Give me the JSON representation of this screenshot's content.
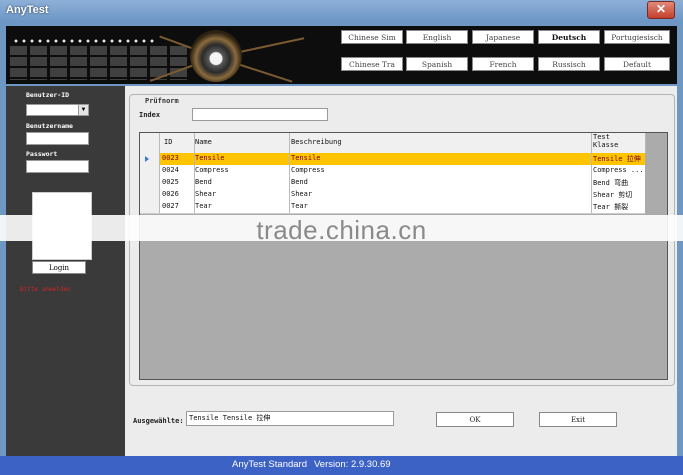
{
  "window": {
    "title": "AnyTest",
    "close_label": "✕"
  },
  "languages": [
    {
      "label": "Chinese Sim",
      "active": false
    },
    {
      "label": "English",
      "active": false
    },
    {
      "label": "Japanese",
      "active": false
    },
    {
      "label": "Deutsch",
      "active": true
    },
    {
      "label": "Portugiesisch",
      "active": false
    },
    {
      "label": "Chinese Tra",
      "active": false
    },
    {
      "label": "Spanish",
      "active": false
    },
    {
      "label": "French",
      "active": false
    },
    {
      "label": "Russisch",
      "active": false
    },
    {
      "label": "Default",
      "active": false
    }
  ],
  "sidebar": {
    "user_id_label": "Benutzer-ID",
    "username_label": "Benutzername",
    "password_label": "Passwort",
    "login_label": "Login",
    "warning": "Bitte anmelden"
  },
  "form": {
    "group_title": "Prüfnorm",
    "index_label": "Index",
    "index_value": "",
    "selected_label": "Ausgewählte:",
    "selected_value": "Tensile   Tensile 拉伸",
    "ok_label": "OK",
    "exit_label": "Exit"
  },
  "table": {
    "headers": [
      "ID",
      "Name",
      "Beschreibung",
      "Test Klasse"
    ],
    "rows": [
      {
        "id": "0023",
        "name": "Tensile",
        "desc": "Tensile",
        "cls": "Tensile 拉伸",
        "selected": true
      },
      {
        "id": "0024",
        "name": "Compress",
        "desc": "Compress",
        "cls": "Compress ...",
        "selected": false
      },
      {
        "id": "0025",
        "name": "Bend",
        "desc": "Bend",
        "cls": "Bend 弯曲",
        "selected": false
      },
      {
        "id": "0026",
        "name": "Shear",
        "desc": "Shear",
        "cls": "Shear 剪切",
        "selected": false
      },
      {
        "id": "0027",
        "name": "Tear",
        "desc": "Tear",
        "cls": "Tear 撕裂",
        "selected": false
      }
    ]
  },
  "watermark": "trade.china.cn",
  "status": {
    "app": "AnyTest Standard",
    "version": "Version: 2.9.30.69"
  },
  "colors": {
    "highlight": "#ffc400",
    "status_bar": "#3d62c6",
    "title_bar": "#6c96c5"
  }
}
